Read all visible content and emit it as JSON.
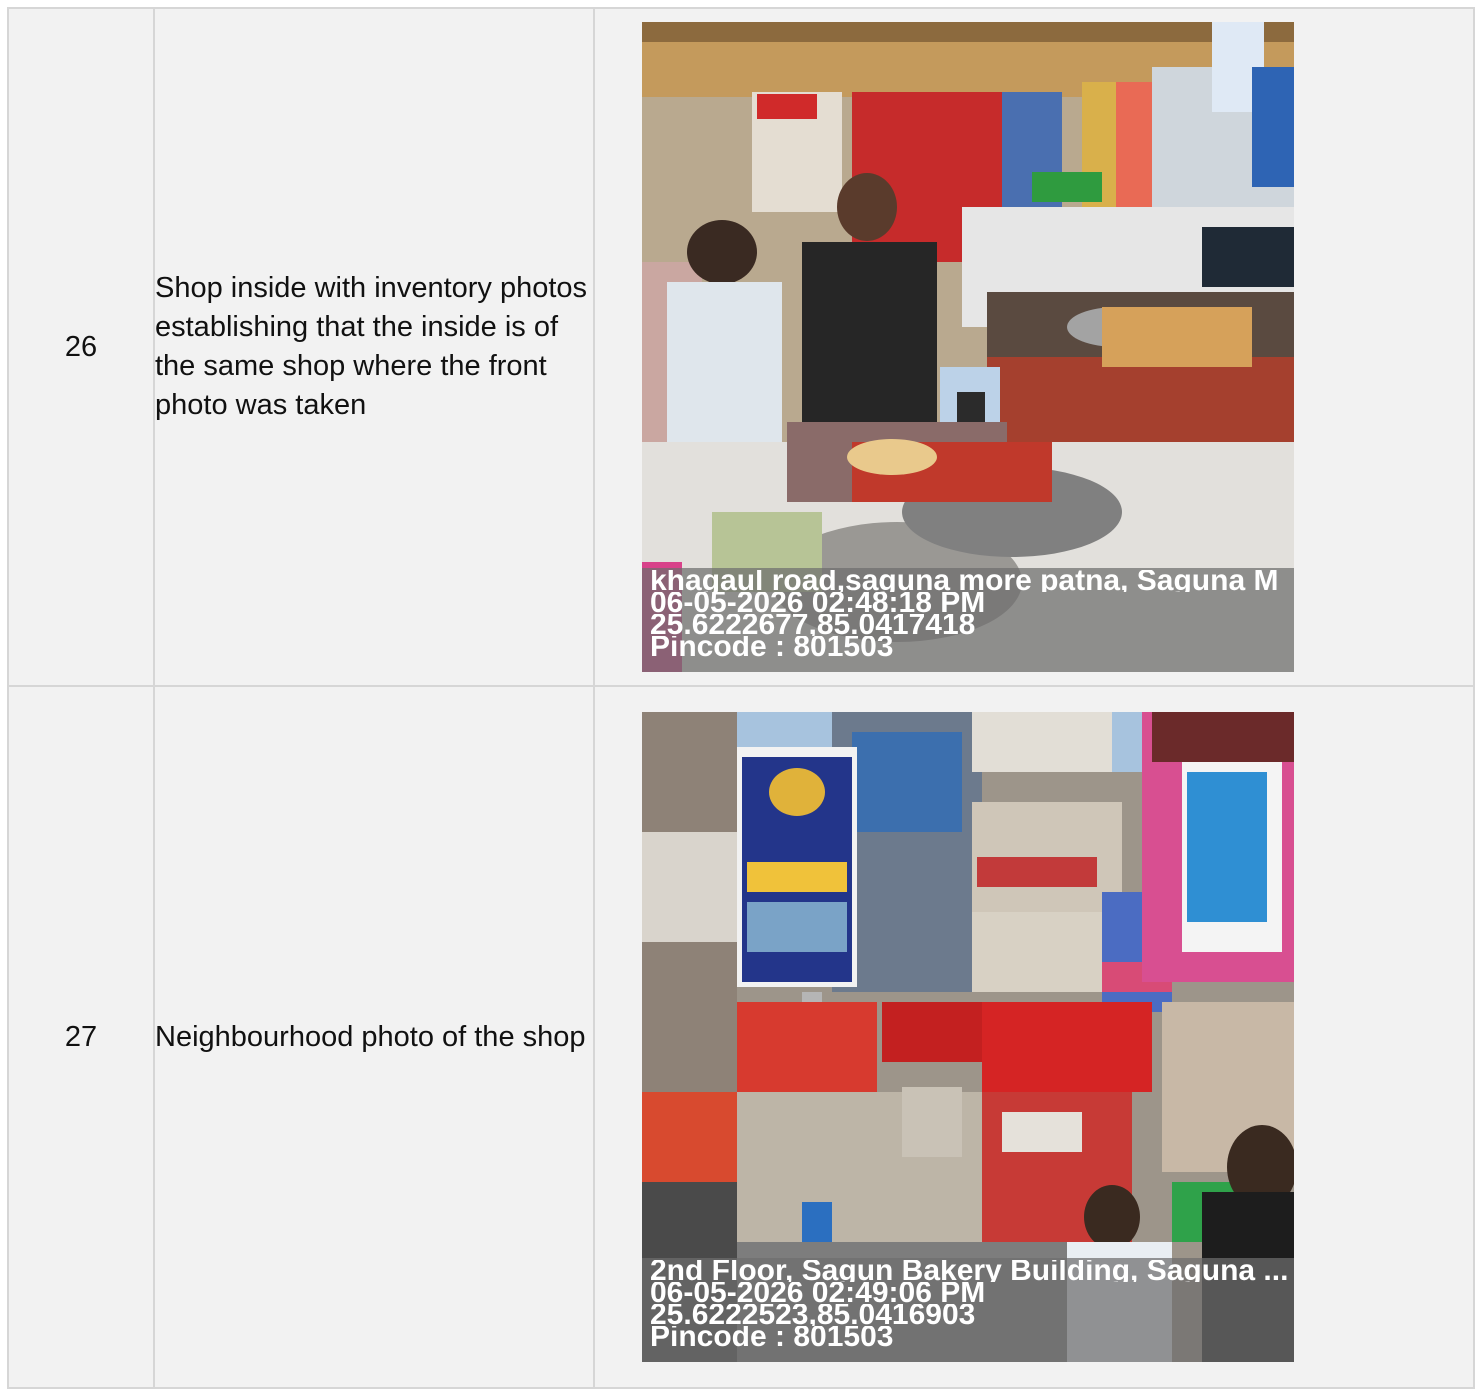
{
  "rows": [
    {
      "number": "26",
      "description": "Shop inside with inventory photos establishing that the inside is of the same shop where the front photo was taken",
      "photo": {
        "address": "khagaul road,saguna more patna, Saguna M",
        "datetime": "06-05-2026 02:48:18 PM",
        "coords": "25.6222677,85.0417418",
        "pincode": "Pincode : 801503"
      }
    },
    {
      "number": "27",
      "description": "Neighbourhood photo of the shop",
      "photo": {
        "address": "2nd Floor, Sagun Bakery Building, Saguna ...",
        "datetime": "06-05-2026 02:49:06 PM",
        "coords": "25.6222523,85.0416903",
        "pincode": "Pincode : 801503"
      }
    }
  ]
}
